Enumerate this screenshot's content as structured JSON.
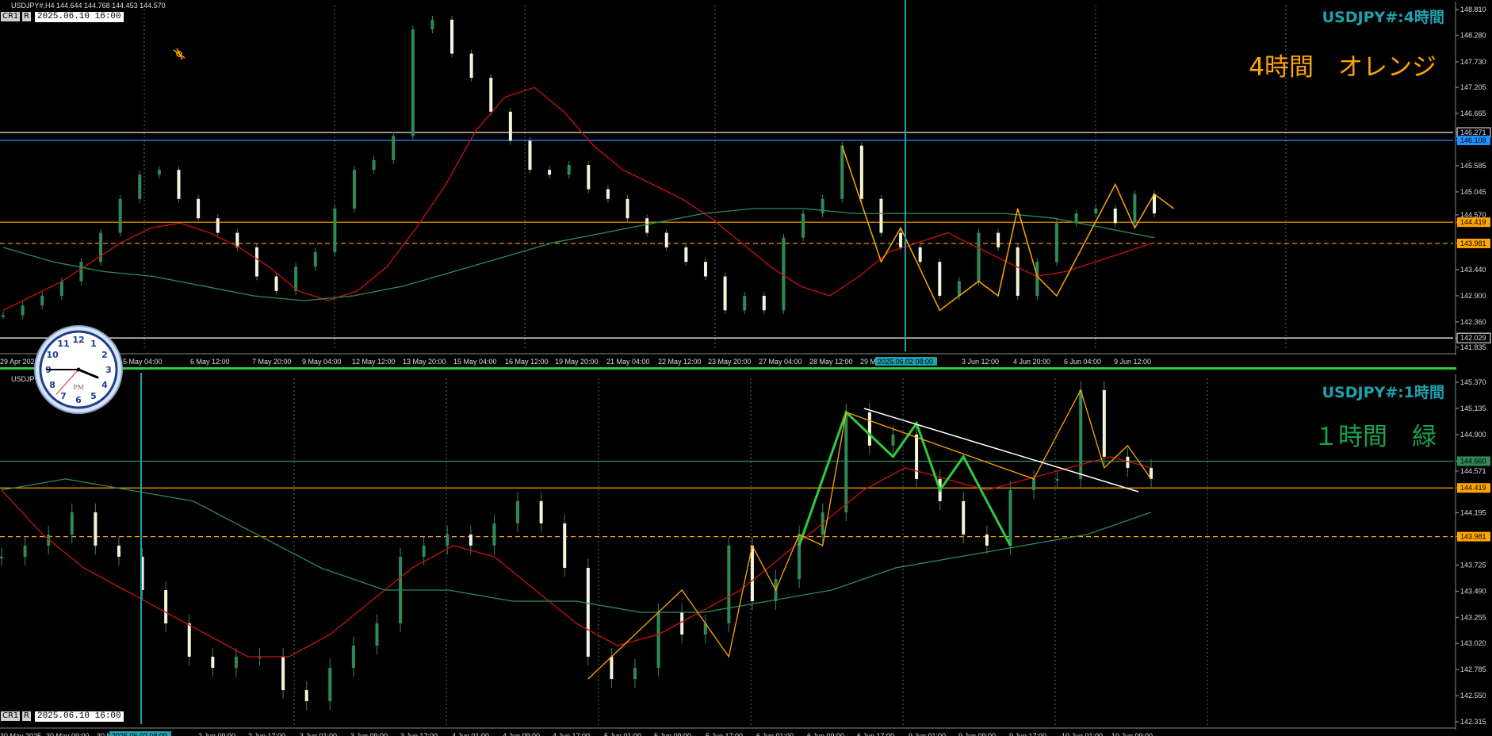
{
  "top": {
    "header": "USDJPY#,H4  144.644 144.768 144.453 144.570",
    "title": "USDJPY#:4時間",
    "note": "4時間　オレンジ",
    "cr_label": "CR1",
    "r_label": "R",
    "timestamp": "2025.06.10 16:00",
    "price_ticks": [
      "148.810",
      "148.280",
      "147.730",
      "147.205",
      "146.665",
      "146.271",
      "146.108",
      "145.585",
      "145.045",
      "144.570",
      "144.419",
      "143.981",
      "143.440",
      "142.900",
      "142.360",
      "142.029",
      "141.835"
    ],
    "time_ticks": [
      "29 Apr 2025",
      "5 May 04:00",
      "6 May 12:00",
      "7 May 20:00",
      "9 May 04:00",
      "12 May 12:00",
      "13 May 20:00",
      "15 May 04:00",
      "16 May 12:00",
      "19 May 20:00",
      "21 May 04:00",
      "22 May 12:00",
      "23 May 20:00",
      "27 May 04:00",
      "28 May 12:00",
      "29 M",
      "3 Jun 12:00",
      "4 Jun 20:00",
      "6 Jun 04:00",
      "9 Jun 12:00"
    ],
    "cursor_time": "2025.06.02 08:00"
  },
  "bottom": {
    "header": "USDJPY#,H1  144.453 144.571",
    "title": "USDJPY#:1時間",
    "note": "１時間　緑",
    "cr_label": "CR1",
    "r_label": "R",
    "timestamp": "2025.06.10 16:00",
    "price_ticks": [
      "145.370",
      "145.135",
      "144.900",
      "144.660",
      "144.571",
      "144.419",
      "144.195",
      "143.981",
      "143.725",
      "143.490",
      "143.255",
      "143.020",
      "142.785",
      "142.550",
      "142.315"
    ],
    "time_ticks": [
      "30 May 2025",
      "30 May 09:00",
      "30 M",
      "2 Jun 09:00",
      "2 Jun 17:00",
      "3 Jun 01:00",
      "3 Jun 09:00",
      "3 Jun 17:00",
      "4 Jun 01:00",
      "4 Jun 09:00",
      "4 Jun 17:00",
      "5 Jun 01:00",
      "5 Jun 09:00",
      "5 Jun 17:00",
      "6 Jun 01:00",
      "6 Jun 09:00",
      "6 Jun 17:00",
      "9 Jun 01:00",
      "9 Jun 09:00",
      "9 Jun 17:00",
      "10 Jun 01:00",
      "10 Jun 09:00"
    ],
    "cursor_time": "2025.06.02 08:00"
  },
  "clock": {
    "numbers": [
      "12",
      "1",
      "2",
      "3",
      "4",
      "5",
      "6",
      "7",
      "8",
      "9",
      "10",
      "11"
    ],
    "ampm": "PM",
    "hour": 3,
    "minute": 45,
    "second": 37
  },
  "chart_data": [
    {
      "type": "line",
      "title": "USDJPY#:4時間",
      "ylim": [
        141.835,
        148.81
      ],
      "levels": [
        {
          "price": 146.271,
          "color": "#ffffff"
        },
        {
          "price": 146.108,
          "color": "#1e90ff"
        },
        {
          "price": 144.419,
          "color": "#ffa500"
        },
        {
          "price": 143.981,
          "color": "#ffa500",
          "dashed": true
        },
        {
          "price": 142.029,
          "color": "#ffffff"
        }
      ],
      "series": [
        {
          "color": "#ffffff",
          "values": [
            142.5,
            142.7,
            142.9,
            143.2,
            143.6,
            144.2,
            144.9,
            145.4,
            145.5,
            144.9,
            144.5,
            144.2,
            143.9,
            143.3,
            143.0,
            143.5,
            143.8,
            144.7,
            145.5,
            145.7,
            146.2,
            148.4,
            148.6,
            147.9,
            147.4,
            146.7,
            146.1,
            145.5,
            145.4,
            145.6,
            145.1,
            144.9,
            144.5,
            144.2,
            143.9,
            143.6,
            143.3,
            142.6,
            142.9,
            142.6,
            144.1,
            144.6,
            144.9,
            146.0,
            144.9,
            144.2,
            143.9,
            143.6,
            142.9,
            143.2,
            144.2,
            143.9,
            142.9,
            143.6,
            144.4,
            144.6,
            144.7,
            144.4,
            145.0,
            144.6
          ]
        },
        {
          "color": "#cc1111",
          "values": [
            142.6,
            142.9,
            143.2,
            143.6,
            144.0,
            144.3,
            144.4,
            144.2,
            143.9,
            143.5,
            143.0,
            142.8,
            143.0,
            143.5,
            144.3,
            145.2,
            146.3,
            147.0,
            147.2,
            146.7,
            146.0,
            145.5,
            145.2,
            144.9,
            144.5,
            144.0,
            143.5,
            143.1,
            142.9,
            143.3,
            143.8,
            144.0,
            144.2,
            143.9,
            143.6,
            143.3,
            143.4,
            143.6,
            143.8,
            144.0
          ]
        },
        {
          "color": "#2e8b57",
          "values": [
            143.9,
            143.6,
            143.4,
            143.3,
            143.1,
            142.9,
            142.8,
            142.9,
            143.1,
            143.4,
            143.7,
            144.0,
            144.2,
            144.4,
            144.6,
            144.7,
            144.7,
            144.6,
            144.6,
            144.6,
            144.6,
            144.5,
            144.3,
            144.1
          ]
        }
      ]
    },
    {
      "type": "line",
      "title": "USDJPY#:1時間",
      "ylim": [
        142.315,
        145.37
      ],
      "levels": [
        {
          "price": 144.66,
          "color": "#2e8b57"
        },
        {
          "price": 144.419,
          "color": "#ffa500"
        },
        {
          "price": 143.981,
          "color": "#ffa500",
          "dashed": true
        }
      ],
      "series": [
        {
          "color": "#ffffff",
          "values": [
            143.8,
            143.9,
            144.0,
            144.2,
            143.9,
            143.8,
            143.5,
            143.2,
            142.9,
            142.8,
            142.9,
            142.9,
            142.6,
            142.5,
            142.8,
            143.0,
            143.2,
            143.8,
            143.9,
            144.0,
            143.9,
            144.1,
            144.3,
            144.1,
            143.7,
            142.9,
            142.7,
            142.8,
            143.3,
            143.1,
            143.2,
            143.9,
            143.4,
            143.6,
            144.0,
            144.2,
            145.1,
            144.8,
            144.9,
            144.5,
            144.3,
            144.0,
            143.9,
            144.4,
            144.5,
            144.5,
            145.3,
            144.7,
            144.6,
            144.5
          ]
        },
        {
          "color": "#cc1111",
          "values": [
            144.4,
            144.0,
            143.7,
            143.5,
            143.3,
            143.1,
            142.9,
            142.9,
            143.1,
            143.4,
            143.7,
            143.9,
            143.8,
            143.5,
            143.2,
            143.0,
            143.1,
            143.3,
            143.5,
            143.8,
            144.1,
            144.4,
            144.6,
            144.5,
            144.4,
            144.5,
            144.6,
            144.7,
            144.6
          ]
        },
        {
          "color": "#2e8b57",
          "values": [
            144.4,
            144.5,
            144.4,
            144.3,
            144.0,
            143.7,
            143.5,
            143.5,
            143.4,
            143.4,
            143.3,
            143.3,
            143.4,
            143.5,
            143.7,
            143.8,
            143.9,
            144.0,
            144.2
          ]
        }
      ]
    }
  ]
}
